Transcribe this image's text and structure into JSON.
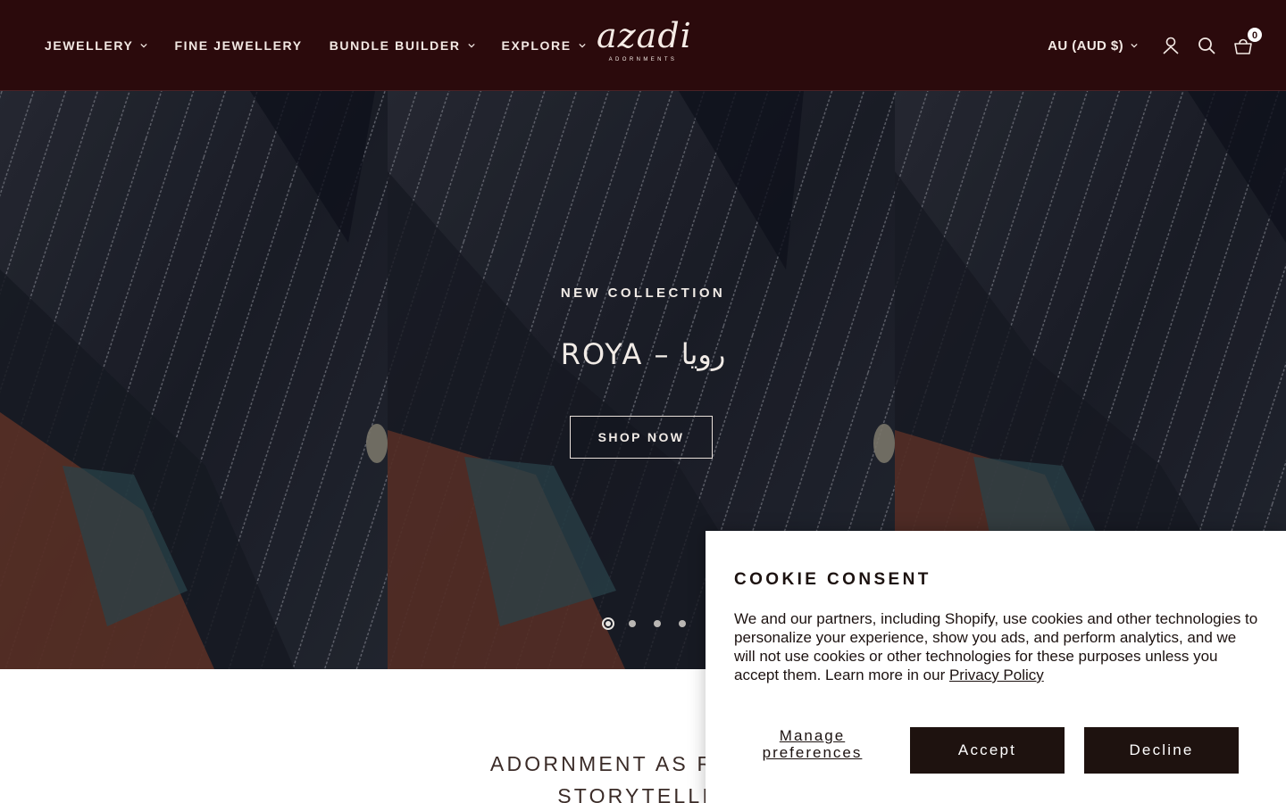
{
  "header": {
    "nav": [
      {
        "label": "JEWELLERY",
        "has_dropdown": true
      },
      {
        "label": "FINE JEWELLERY",
        "has_dropdown": false
      },
      {
        "label": "BUNDLE BUILDER",
        "has_dropdown": true
      },
      {
        "label": "EXPLORE",
        "has_dropdown": true
      }
    ],
    "logo": {
      "word": "azadi",
      "sub": "ADORNMENTS"
    },
    "currency": "AU (AUD $)",
    "icons": [
      "account-icon",
      "search-icon",
      "cart-icon"
    ],
    "cart_count": "0",
    "background": "#2b0a0c"
  },
  "hero": {
    "eyebrow": "NEW COLLECTION",
    "title": "ROYA – رویا",
    "button": "SHOP NOW",
    "slides": 4,
    "active_slide": 1
  },
  "tagline": "ADORNMENT AS RITUAL. … STORYTELLIN",
  "tagline_lines": [
    "ADORNMENT AS RITUAL.",
    "STORYTELLIN"
  ],
  "cookie": {
    "title": "COOKIE CONSENT",
    "body": "We and our partners, including Shopify, use cookies and other technologies to personalize your experience, show you ads, and perform analytics, and we will not use cookies or other technologies for these purposes unless you accept them. Learn more in our",
    "privacy_link": "Privacy Policy",
    "manage": "Manage preferences",
    "accept": "Accept",
    "decline": "Decline",
    "button_color": "#1e120f"
  }
}
